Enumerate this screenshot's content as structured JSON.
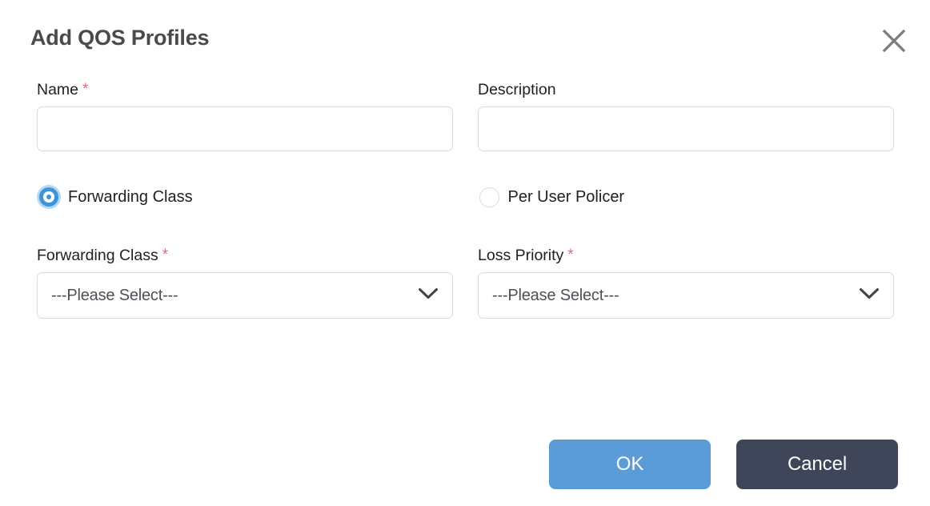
{
  "dialog": {
    "title": "Add QOS Profiles",
    "close_icon": "close-icon"
  },
  "form": {
    "name": {
      "label": "Name",
      "required_mark": "*",
      "value": "",
      "placeholder": ""
    },
    "description": {
      "label": "Description",
      "required_mark": "",
      "value": "",
      "placeholder": ""
    },
    "mode_radios": [
      {
        "label": "Forwarding Class",
        "selected": true
      },
      {
        "label": "Per User Policer",
        "selected": false
      }
    ],
    "forwarding_class": {
      "label": "Forwarding Class",
      "required_mark": "*",
      "selected_option": "---Please Select---",
      "chevron_icon": "chevron-down-icon"
    },
    "loss_priority": {
      "label": "Loss Priority",
      "required_mark": "*",
      "selected_option": "---Please Select---",
      "chevron_icon": "chevron-down-icon"
    }
  },
  "footer": {
    "ok_label": "OK",
    "cancel_label": "Cancel"
  },
  "colors": {
    "primary_blue": "#5b9bd8",
    "radio_blue": "#3c95da",
    "radio_halo": "#b6d8f2",
    "cancel_dark": "#3f4659",
    "required_red": "#e36a78",
    "border_gray": "#dadbdc",
    "title_gray": "#4a4a4a",
    "text_dark": "#212121",
    "select_text": "#4a5158"
  }
}
